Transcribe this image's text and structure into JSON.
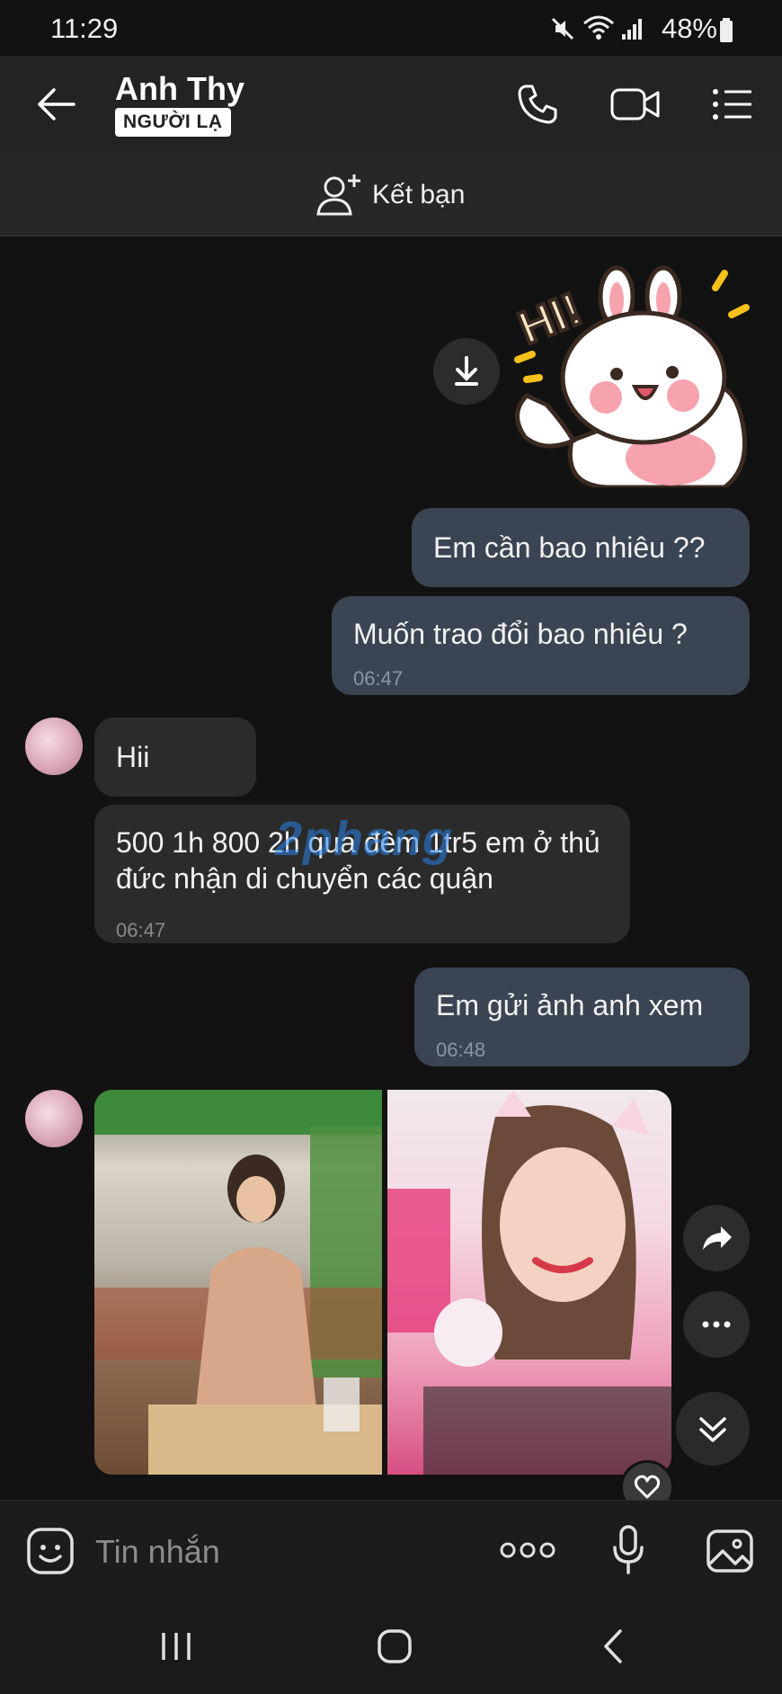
{
  "status": {
    "time": "11:29",
    "battery": "48%"
  },
  "header": {
    "contact_name": "Anh Thy",
    "badge": "NGƯỜI LẠ"
  },
  "add_friend": {
    "label": "Kết bạn"
  },
  "messages": [
    {
      "side": "sent",
      "text": "Em cần bao nhiêu ??"
    },
    {
      "side": "sent",
      "text": "Muốn trao đổi bao nhiêu ?",
      "time": "06:47"
    },
    {
      "side": "received",
      "text": "Hii"
    },
    {
      "side": "received",
      "text": "500 1h 800 2h qua đêm 1tr5 em ở thủ đức nhận di chuyển các quận",
      "time": "06:47"
    },
    {
      "side": "sent",
      "text": "Em gửi ảnh anh xem",
      "time": "06:48"
    }
  ],
  "watermark": "2phang",
  "input": {
    "placeholder": "Tin nhắn"
  },
  "colors": {
    "sent_bubble": "#3a4453",
    "received_bubble": "#2b2b2b",
    "background": "#121212"
  }
}
